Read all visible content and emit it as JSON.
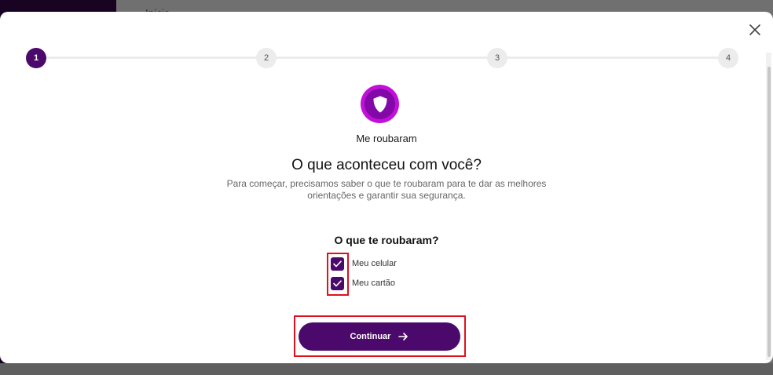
{
  "background": {
    "tab_label": "Início"
  },
  "modal": {
    "close_icon": "close-icon",
    "stepper": {
      "steps": [
        {
          "label": "1",
          "state": "active"
        },
        {
          "label": "2",
          "state": "inactive"
        },
        {
          "label": "3",
          "state": "inactive"
        },
        {
          "label": "4",
          "state": "inactive"
        }
      ]
    },
    "category_icon": "shield-icon",
    "category_label": "Me roubaram",
    "title": "O que aconteceu com você?",
    "subtitle": "Para começar, precisamos saber o que te roubaram para te dar as melhores orientações e garantir sua segurança.",
    "question": "O que te roubaram?",
    "options": [
      {
        "label": "Meu celular",
        "checked": true
      },
      {
        "label": "Meu cartão",
        "checked": true
      }
    ],
    "continue_label": "Continuar",
    "continue_icon": "arrow-right-icon"
  },
  "colors": {
    "brand_purple": "#4b0a6b",
    "badge_magenta": "#c310d9",
    "highlight_red": "#e0101e"
  }
}
